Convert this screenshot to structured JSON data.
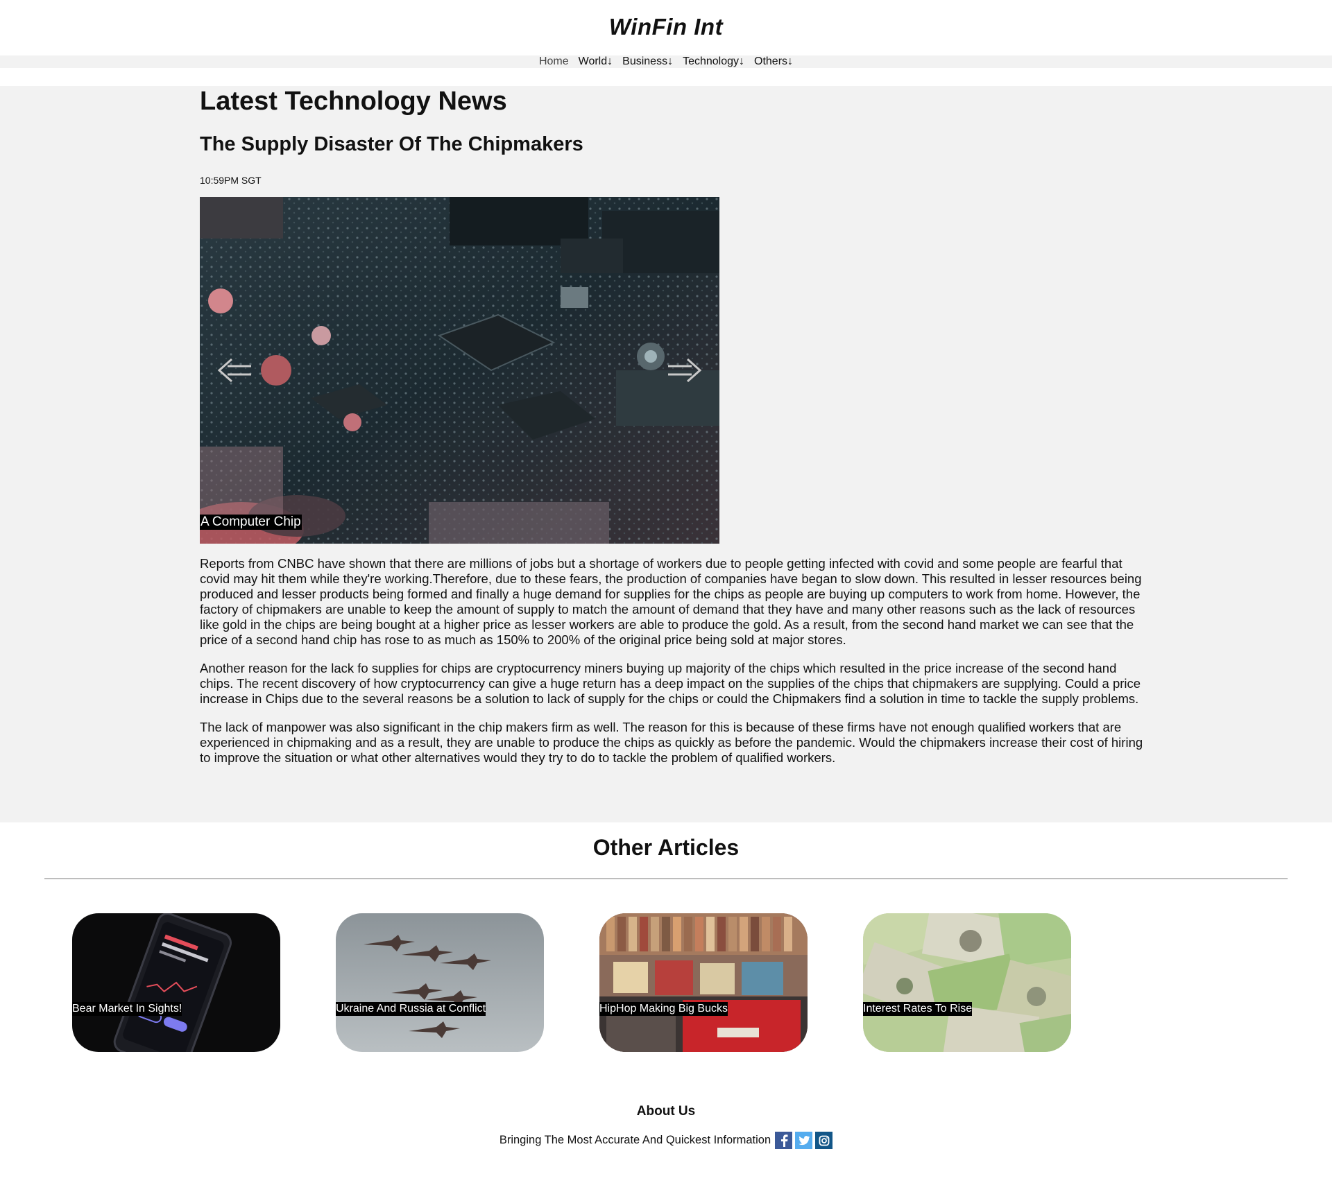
{
  "site": {
    "title": "WinFin Int"
  },
  "nav": {
    "items": [
      {
        "label": "Home"
      },
      {
        "label": "World↓"
      },
      {
        "label": "Business↓"
      },
      {
        "label": "Technology↓"
      },
      {
        "label": "Others↓"
      }
    ]
  },
  "main": {
    "section_title": "Latest Technology News",
    "article_title": "The Supply Disaster Of The Chipmakers",
    "timestamp": "10:59PM SGT",
    "carousel": {
      "caption": "A Computer Chip",
      "prev_icon": "left-arrow-icon",
      "next_icon": "right-arrow-icon"
    },
    "paragraphs": [
      "Reports from CNBC have shown that there are millions of jobs but a shortage of workers due to people getting infected with covid and some people are fearful that covid may hit them while they're working.Therefore, due to these fears, the production of companies have began to slow down. This resulted in lesser resources being produced and lesser products being formed and finally a huge demand for supplies for the chips as people are buying up computers to work from home. However, the factory of chipmakers are unable to keep the amount of supply to match the amount of demand that they have and many other reasons such as the lack of resources like gold in the chips are being bought at a higher price as lesser workers are able to produce the gold. As a result, from the second hand market we can see that the price of a second hand chip has rose to as much as 150% to 200% of the original price being sold at major stores.",
      "Another reason for the lack fo supplies for chips are cryptocurrency miners buying up majority of the chips which resulted in the price increase of the second hand chips. The recent discovery of how cryptocurrency can give a huge return has a deep impact on the supplies of the chips that chipmakers are supplying. Could a price increase in Chips due to the several reasons be a solution to lack of supply for the chips or could the Chipmakers find a solution in time to tackle the supply problems.",
      "The lack of manpower was also significant in the chip makers firm as well. The reason for this is because of these firms have not enough qualified workers that are experienced in chipmaking and as a result, they are unable to produce the chips as quickly as before the pandemic. Would the chipmakers increase their cost of hiring to improve the situation or what other alternatives would they try to do to tackle the problem of qualified workers."
    ]
  },
  "other_articles": {
    "title": "Other Articles",
    "cards": [
      {
        "label": "Bear Market In Sights!"
      },
      {
        "label": "Ukraine And Russia at Conflict"
      },
      {
        "label": "HipHop Making Big Bucks"
      },
      {
        "label": "Interest Rates To Rise"
      }
    ]
  },
  "footer": {
    "about_title": "About Us",
    "tagline": "Bringing The Most Accurate And Quickest Information",
    "social": [
      "facebook-icon",
      "twitter-icon",
      "instagram-icon"
    ]
  },
  "colors": {
    "page_bg": "#ffffff",
    "main_bg": "#f2f2f2",
    "facebook": "#3b5998",
    "twitter": "#55acee",
    "instagram": "#125688"
  }
}
